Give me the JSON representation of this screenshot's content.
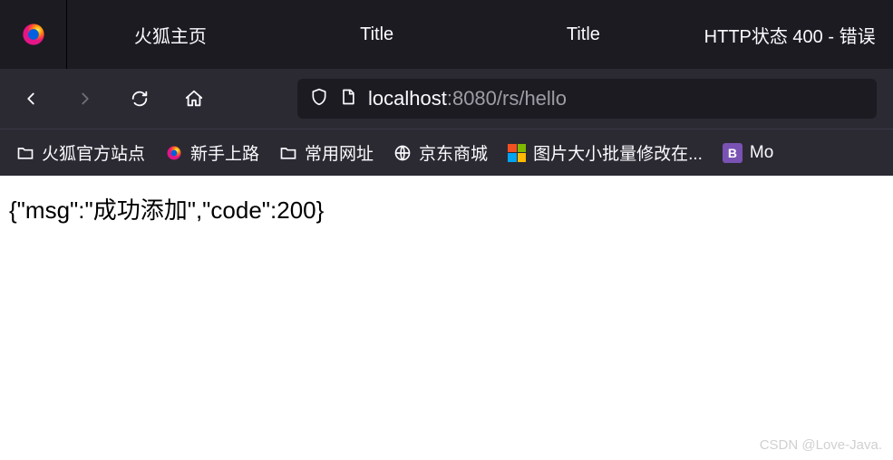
{
  "tabs": [
    {
      "label": "火狐主页"
    },
    {
      "label": "Title"
    },
    {
      "label": "Title"
    },
    {
      "label": "HTTP状态 400 - 错误"
    }
  ],
  "url": {
    "host": "localhost",
    "port_path": ":8080/rs/hello"
  },
  "bookmarks": [
    {
      "label": "火狐官方站点",
      "icon": "folder"
    },
    {
      "label": "新手上路",
      "icon": "firefox"
    },
    {
      "label": "常用网址",
      "icon": "folder"
    },
    {
      "label": "京东商城",
      "icon": "globe"
    },
    {
      "label": "图片大小批量修改在...",
      "icon": "colors"
    },
    {
      "label": "Mo",
      "icon": "bootstrap"
    }
  ],
  "page_body": "{\"msg\":\"成功添加\",\"code\":200}",
  "watermark": "CSDN @Love-Java."
}
